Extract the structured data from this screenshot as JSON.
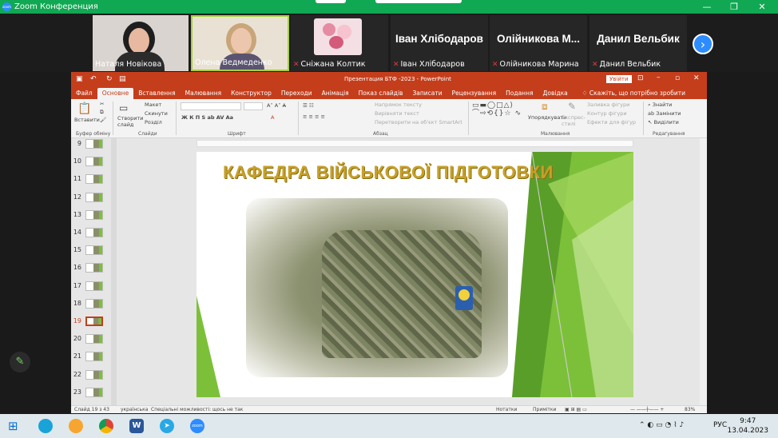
{
  "zoom": {
    "title": "Zoom Конференция",
    "logo": "zoom",
    "min_glyph": "—",
    "max_glyph": "❐",
    "close_glyph": "✕"
  },
  "participants": [
    {
      "name": "Наталя Новікова",
      "muted": false,
      "video": true
    },
    {
      "name": "Олена Ведмеденко",
      "muted": false,
      "video": true,
      "speaking": true
    },
    {
      "name": "Сніжана Колтик",
      "muted": true,
      "video": false
    },
    {
      "name": "Іван Хлібодаров",
      "big": "Іван Хлібодаров",
      "muted": true
    },
    {
      "name": "Олійникова Марина",
      "big": "Олійникова М...",
      "muted": true
    },
    {
      "name": "Данил Вельбик",
      "big": "Данил Вельбик",
      "muted": true
    }
  ],
  "next_glyph": "›",
  "ppt": {
    "title": "Презентация БТФ -2023  -  PowerPoint",
    "signin": "Увійти",
    "tabs": [
      "Файл",
      "Основне",
      "Вставлення",
      "Малювання",
      "Конструктор",
      "Переходи",
      "Анімація",
      "Показ слайдів",
      "Записати",
      "Рецензування",
      "Подання",
      "Довідка"
    ],
    "active_tab": "Основне",
    "tellme": "Скажіть, що потрібно зробити",
    "ribbon": {
      "paste": "Вставити",
      "new_slide": "Створити слайд",
      "layout": "Макет",
      "reset": "Скинути",
      "section": "Розділ",
      "text_dir": "Напрямок тексту",
      "align_text": "Вирівняти текст",
      "smartart": "Перетворити на об'єкт SmartArt",
      "arrange": "Упорядкувати",
      "quick_styles": "Експрес-стилі",
      "fill": "Заливка фігури",
      "outline": "Контур фігури",
      "effects": "Ефекти для фігур",
      "find": "Знайти",
      "replace": "Замінити",
      "select": "Виділити",
      "groups": [
        "Буфер обміну",
        "Слайди",
        "Шрифт",
        "Абзац",
        "Малювання",
        "Редагування"
      ]
    },
    "thumbs": [
      9,
      10,
      11,
      12,
      13,
      14,
      15,
      16,
      17,
      18,
      19,
      20,
      21,
      22,
      23
    ],
    "current_slide": 19,
    "slide": {
      "title": "КАФЕДРА ВІЙСЬКОВОЇ ПІДГОТОВКИ"
    },
    "status": {
      "slide_of": "Слайд 19 з 43",
      "lang": "українська",
      "access": "Спеціальні можливості: щось не так",
      "notes": "Нотатки",
      "comments": "Примітки",
      "zoom": "83%"
    }
  },
  "taskbar": {
    "lang": "РУС",
    "time": "9:47",
    "date": "13.04.2023"
  },
  "colors": {
    "zoom_green": "#11a853",
    "ppt_red": "#c43e1c",
    "slide_gold": "#c6a028",
    "slide_green": "#7cc03a"
  }
}
